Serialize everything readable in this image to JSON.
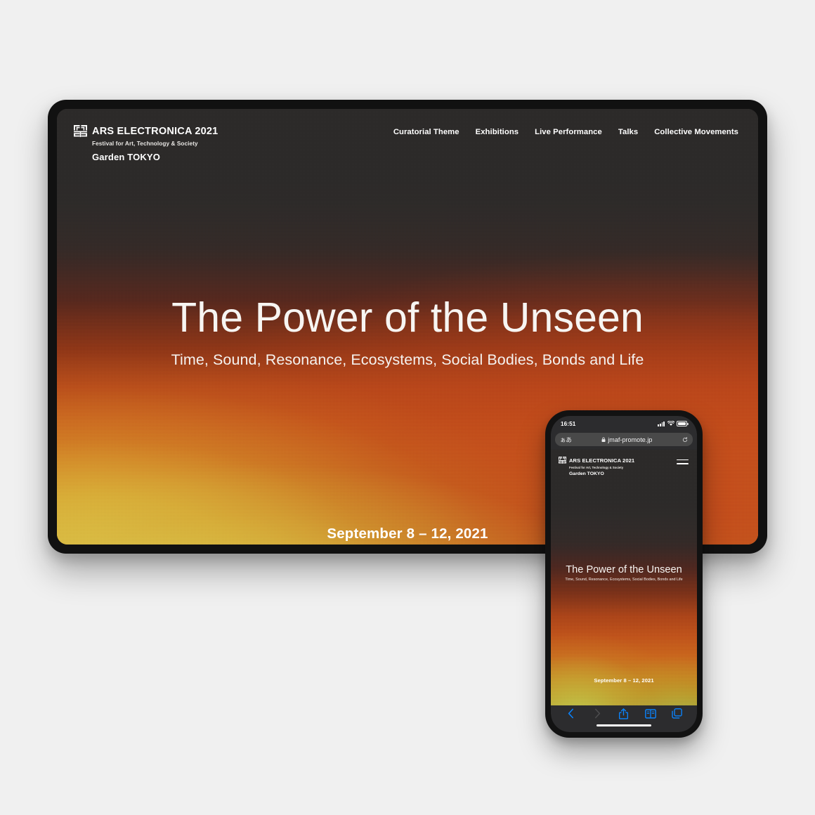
{
  "page": {
    "background_color": "#f0f0f0",
    "description": "Responsive website mockup shown on a tablet and a smartphone"
  },
  "brand": {
    "logo_icon": "ars-electronica-maze-mark",
    "title": "ARS ELECTRONICA 2021",
    "subtitle": "Festival for Art, Technology & Society",
    "garden": "Garden TOKYO"
  },
  "tablet": {
    "device": "tablet-device",
    "nav": [
      {
        "label": "Curatorial Theme"
      },
      {
        "label": "Exhibitions"
      },
      {
        "label": "Live Performance"
      },
      {
        "label": "Talks"
      },
      {
        "label": "Collective Movements"
      }
    ],
    "hero": {
      "title": "The Power of the Unseen",
      "subtitle": "Time, Sound, Resonance, Ecosystems, Social Bodies, Bonds and Life",
      "date": "September 8 – 12, 2021"
    },
    "colors": {
      "top": "#2e2c2b",
      "mid_red": "#8e3617",
      "orange": "#cf6a1d",
      "yellow": "#decc4e"
    }
  },
  "phone": {
    "device": "smartphone-device",
    "status_bar": {
      "time": "16:51",
      "signal_icon": "cellular-signal-icon",
      "wifi_icon": "wifi-icon",
      "battery_icon": "battery-full-icon"
    },
    "browser": {
      "text_size_label": "ぁあ",
      "lock_icon": "lock-icon",
      "url": "jmaf-promote.jp",
      "reload_icon": "reload-icon"
    },
    "menu_icon": "hamburger-menu-icon",
    "hero": {
      "title": "The Power of the Unseen",
      "subtitle": "Time, Sound, Resonance, Ecosystems, Social Bodies, Bonds and Life",
      "date": "September 8 – 12, 2021"
    },
    "toolbar": [
      {
        "icon": "back-chevron-icon",
        "state": "enabled"
      },
      {
        "icon": "forward-chevron-icon",
        "state": "disabled"
      },
      {
        "icon": "share-icon",
        "state": "enabled"
      },
      {
        "icon": "bookmarks-book-icon",
        "state": "enabled"
      },
      {
        "icon": "tabs-icon",
        "state": "enabled"
      }
    ],
    "home_indicator": "home-indicator"
  }
}
